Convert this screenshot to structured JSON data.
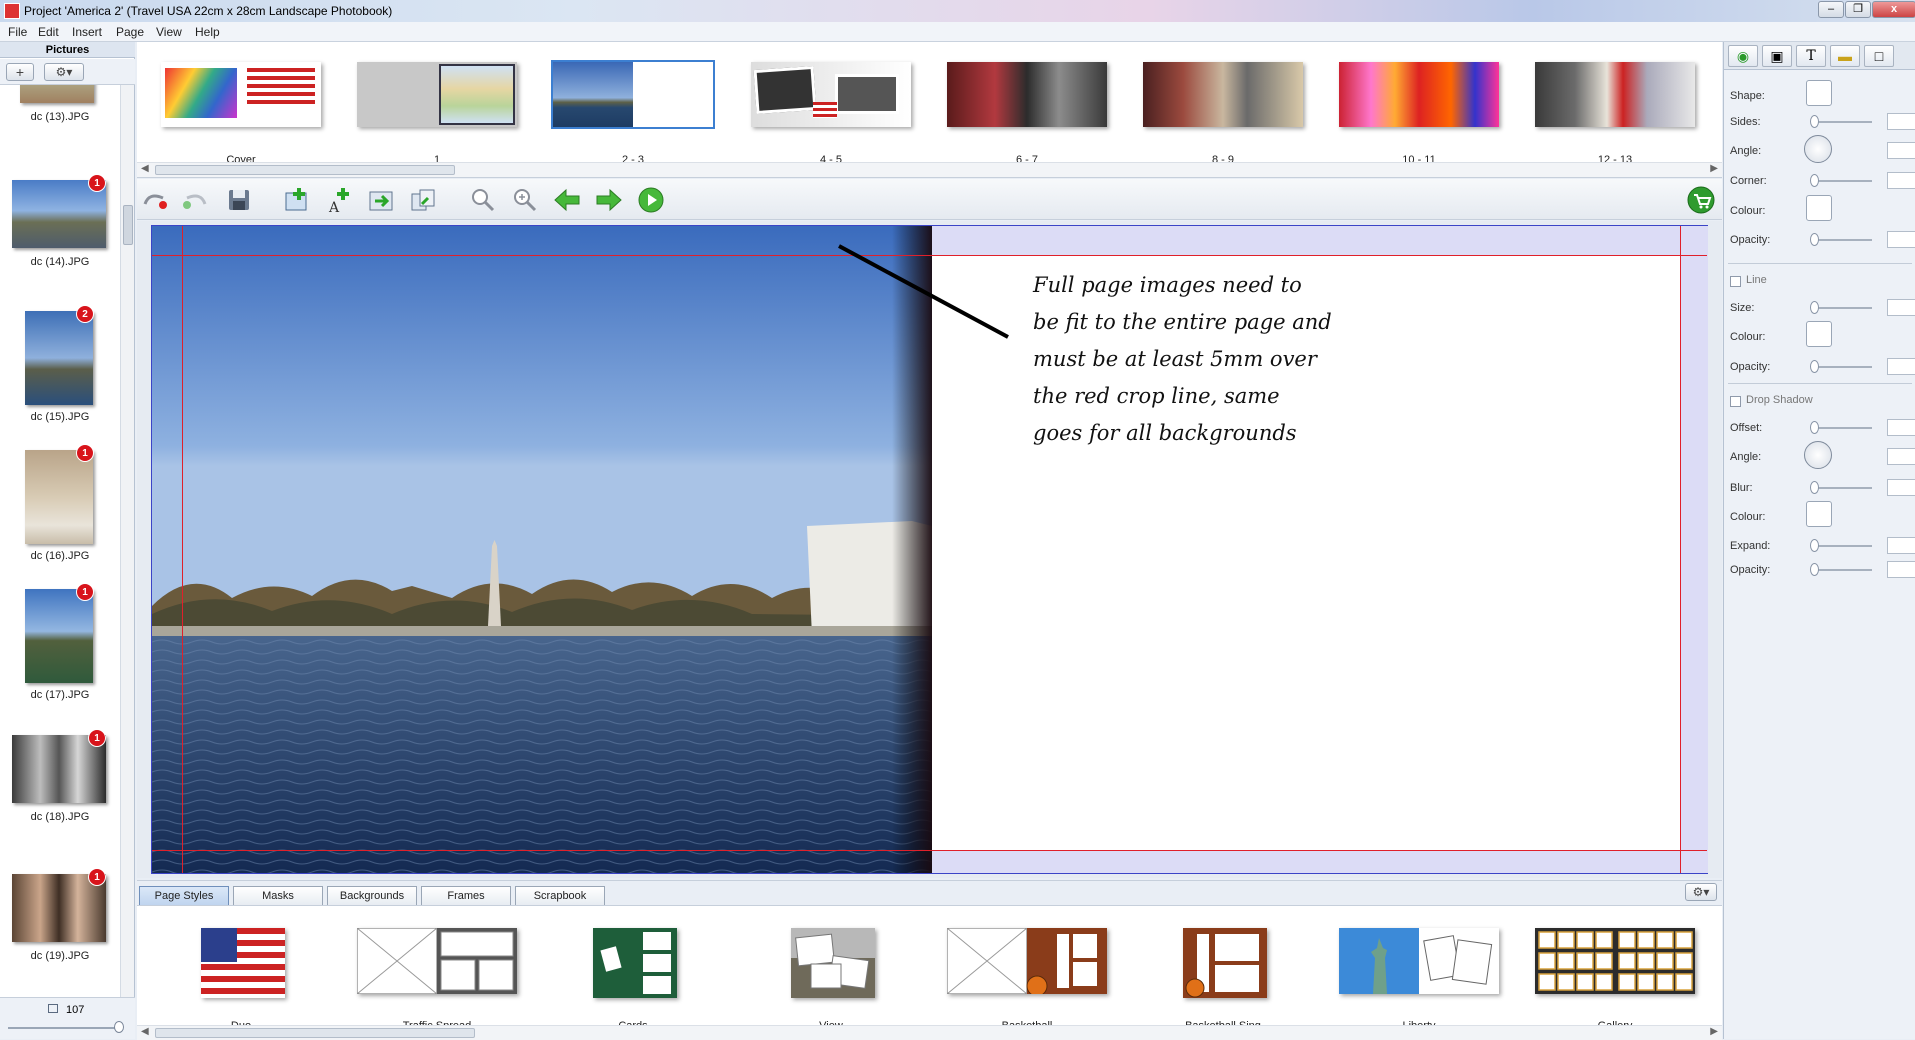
{
  "window": {
    "title": "Project 'America 2' (Travel USA 22cm x 28cm Landscape Photobook)",
    "controls": [
      "–",
      "❐",
      "x"
    ]
  },
  "menu": [
    "File",
    "Edit",
    "Insert",
    "Page",
    "View",
    "Help"
  ],
  "pictures_panel": {
    "header": "Pictures",
    "add_label": "+",
    "settings_label": "⚙▾",
    "count": "107",
    "items": [
      {
        "label": "dc (13).JPG",
        "badge": ""
      },
      {
        "label": "dc (14).JPG",
        "badge": "1"
      },
      {
        "label": "dc (15).JPG",
        "badge": "2"
      },
      {
        "label": "dc (16).JPG",
        "badge": "1"
      },
      {
        "label": "dc (17).JPG",
        "badge": "1"
      },
      {
        "label": "dc (18).JPG",
        "badge": "1"
      },
      {
        "label": "dc (19).JPG",
        "badge": "1"
      }
    ]
  },
  "spreads": [
    {
      "label": "Cover"
    },
    {
      "label": "1"
    },
    {
      "label": "2 - 3",
      "selected": true
    },
    {
      "label": "4 - 5"
    },
    {
      "label": "6 - 7"
    },
    {
      "label": "8 - 9"
    },
    {
      "label": "10 - 11"
    },
    {
      "label": "12 - 13"
    }
  ],
  "toolbar_icons": [
    "undo-icon",
    "redo-icon",
    "save-icon",
    "add-picture-icon",
    "add-text-icon",
    "export-icon",
    "share-icon",
    "zoom-out-icon",
    "zoom-in-icon",
    "previous-page-icon",
    "next-page-icon",
    "preview-icon",
    "cart-icon"
  ],
  "annotation_text": "Full page images need to be fit to the entire page and must be at least 5mm over the red crop line, same goes for all backgrounds",
  "bottom_tabs": [
    {
      "label": "Page Styles",
      "active": true
    },
    {
      "label": "Masks"
    },
    {
      "label": "Backgrounds"
    },
    {
      "label": "Frames"
    },
    {
      "label": "Scrapbook"
    }
  ],
  "page_styles": [
    {
      "label": "Duo"
    },
    {
      "label": "Traffic Spread"
    },
    {
      "label": "Cards"
    },
    {
      "label": "View"
    },
    {
      "label": "Basketball"
    },
    {
      "label": "Basketball Sing"
    },
    {
      "label": "Liberty"
    },
    {
      "label": "Gallery"
    }
  ],
  "properties": {
    "rows": [
      {
        "label": "Shape:",
        "kind": "swatch"
      },
      {
        "label": "Sides:",
        "kind": "slider"
      },
      {
        "label": "Angle:",
        "kind": "dial"
      },
      {
        "label": "Corner:",
        "kind": "slider"
      },
      {
        "label": "Colour:",
        "kind": "swatch"
      },
      {
        "label": "Opacity:",
        "kind": "slider"
      }
    ],
    "line_section": "Line",
    "line_rows": [
      {
        "label": "Size:",
        "kind": "slider"
      },
      {
        "label": "Colour:",
        "kind": "swatch"
      },
      {
        "label": "Opacity:",
        "kind": "slider"
      }
    ],
    "shadow_section": "Drop Shadow",
    "shadow_rows": [
      {
        "label": "Offset:",
        "kind": "slider"
      },
      {
        "label": "Angle:",
        "kind": "dial"
      },
      {
        "label": "Blur:",
        "kind": "slider"
      },
      {
        "label": "Colour:",
        "kind": "swatch"
      },
      {
        "label": "Expand:",
        "kind": "slider"
      },
      {
        "label": "Opacity:",
        "kind": "slider"
      }
    ]
  },
  "colors": {
    "crop_line": "#e0202a",
    "badge": "#d8141b",
    "selection": "#3c7fd1"
  }
}
